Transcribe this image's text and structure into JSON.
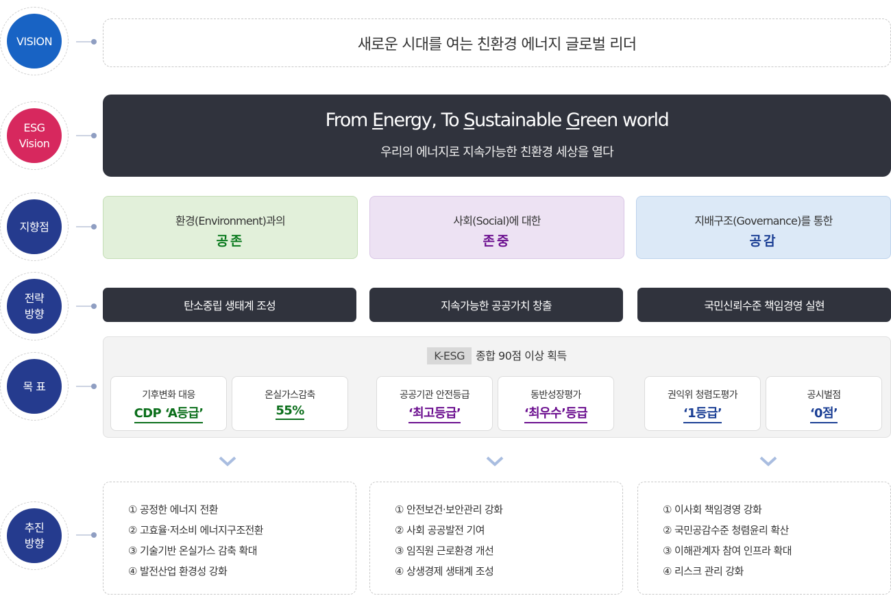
{
  "labels": {
    "vision": "VISION",
    "esg_vision": "ESG\nVision",
    "orientation": "지향점",
    "strategy": "전략\n방향",
    "goals": "목 표",
    "initiatives": "추진\n방향"
  },
  "vision_statement": "새로운 시대를 여는 친환경 에너지 글로벌 리더",
  "esg_vision": {
    "title_parts": [
      "From ",
      "E",
      "nergy, To ",
      "S",
      "ustainable ",
      "G",
      "reen world"
    ],
    "subtitle": "우리의 에너지로 지속가능한 친환경 세상을 열다"
  },
  "orientations": [
    {
      "line1": "환경(Environment)과의",
      "line2": "공존",
      "bg": "#e2f0da",
      "border": "#c3ddb5",
      "color": "#0a7a1e"
    },
    {
      "line1": "사회(Social)에 대한",
      "line2": "존중",
      "bg": "#ede2f3",
      "border": "#d9c6e6",
      "color": "#6a0d8e"
    },
    {
      "line1": "지배구조(Governance)를 통한",
      "line2": "공감",
      "bg": "#dce9f7",
      "border": "#bcd2ec",
      "color": "#1a3e94"
    }
  ],
  "strategies": [
    "탄소중립 생태계 조성",
    "지속가능한 공공가치 창출",
    "국민신뢰수준 책임경영 실현"
  ],
  "goals": {
    "kesg_tag": "K-ESG",
    "kesg_text": "종합 90점 이상 획득",
    "cards": [
      {
        "label": "기후변화 대응",
        "value": "CDP ‘A등급’",
        "color": "#0a6e1a"
      },
      {
        "label": "온실가스감축",
        "value": "55%",
        "color": "#0a6e1a"
      },
      {
        "label": "공공기관 안전등급",
        "value": "‘최고등급’",
        "color": "#6a0d8e"
      },
      {
        "label": "동반성장평가",
        "value": "‘최우수’등급",
        "color": "#6a0d8e"
      },
      {
        "label": "권익위 청렴도평가",
        "value": "‘1등급’",
        "color": "#1a3e94"
      },
      {
        "label": "공시벌점",
        "value": "‘0점’",
        "color": "#1a3e94"
      }
    ]
  },
  "initiatives": [
    [
      "① 공정한 에너지 전환",
      "② 고효율·저소비 에너지구조전환",
      "③ 기술기반 온실가스 감축 확대",
      "④ 발전산업 환경성 강화"
    ],
    [
      "① 안전보건·보안관리 강화",
      "② 사회 공공발전 기여",
      "③ 임직원 근로환경 개선",
      "④ 상생경제 생태계 조성"
    ],
    [
      "① 이사회 책임경영 강화",
      "② 국민공감수준 청렴윤리 확산",
      "③ 이해관계자 참여 인프라 확대",
      "④ 리스크 관리 강화"
    ]
  ]
}
